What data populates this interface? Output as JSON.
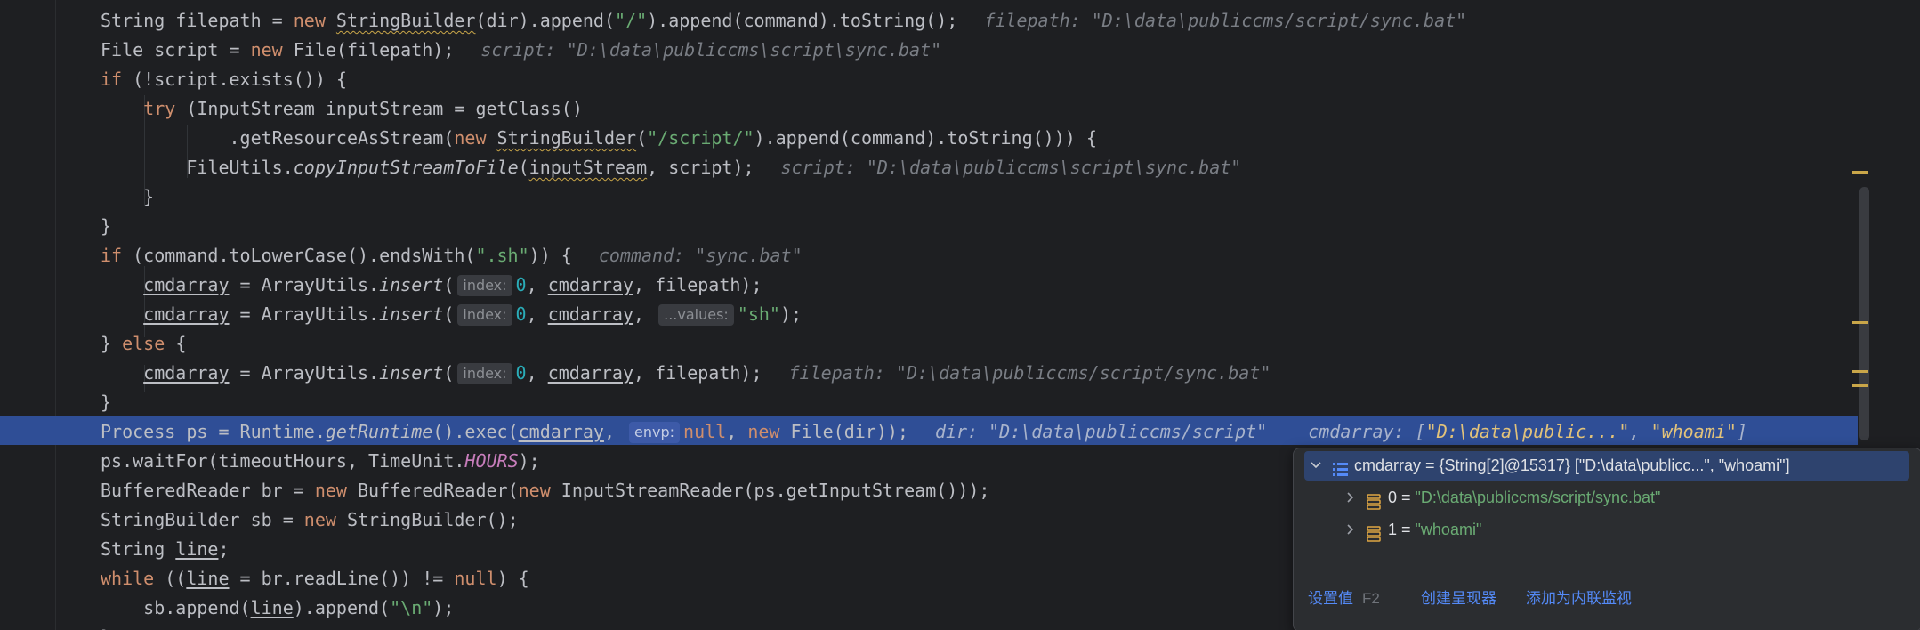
{
  "editor": {
    "lines": [
      [
        {
          "t": "String filepath = "
        },
        {
          "t": "new ",
          "c": "kw"
        },
        {
          "t": "StringBuilder",
          "c": "wavy"
        },
        {
          "t": "(dir).append("
        },
        {
          "t": "\"/\"",
          "c": "str"
        },
        {
          "t": ").append(command).toString();"
        },
        {
          "t": "filepath: \"D:\\data\\publiccms/script/sync.bat\"",
          "c": "inline-hint"
        }
      ],
      [
        {
          "t": "File script = "
        },
        {
          "t": "new ",
          "c": "kw"
        },
        {
          "t": "File(filepath);"
        },
        {
          "t": "script: \"D:\\data\\publiccms\\script\\sync.bat\"",
          "c": "inline-hint"
        }
      ],
      [
        {
          "t": "if ",
          "c": "kw"
        },
        {
          "t": "(!script.exists()) {"
        }
      ],
      [
        {
          "t": "    "
        },
        {
          "t": "try ",
          "c": "kw"
        },
        {
          "t": "(InputStream inputStream = getClass()"
        }
      ],
      [
        {
          "t": "            .getResourceAsStream("
        },
        {
          "t": "new ",
          "c": "kw"
        },
        {
          "t": "StringBuilder",
          "c": "wavy"
        },
        {
          "t": "("
        },
        {
          "t": "\"/script/\"",
          "c": "str"
        },
        {
          "t": ").append(command).toString())) {"
        }
      ],
      [
        {
          "t": "        FileUtils."
        },
        {
          "t": "copyInputStreamToFile",
          "c": "static"
        },
        {
          "t": "("
        },
        {
          "t": "inputStream",
          "c": "wavy"
        },
        {
          "t": ", script);"
        },
        {
          "t": "script: \"D:\\data\\publiccms\\script\\sync.bat\"",
          "c": "inline-hint"
        }
      ],
      [
        {
          "t": "    }"
        }
      ],
      [
        {
          "t": "}"
        }
      ],
      [
        {
          "t": "if ",
          "c": "kw"
        },
        {
          "t": "(command.toLowerCase().endsWith("
        },
        {
          "t": "\".sh\"",
          "c": "str"
        },
        {
          "t": ")) {"
        },
        {
          "t": "command: \"sync.bat\"",
          "c": "inline-hint"
        }
      ],
      [
        {
          "t": "    "
        },
        {
          "t": "cmdarray",
          "c": "ul"
        },
        {
          "t": " = ArrayUtils."
        },
        {
          "t": "insert",
          "c": "static"
        },
        {
          "t": "("
        },
        {
          "t": "index:",
          "c": "param-hint"
        },
        {
          "t": "0",
          "c": "num"
        },
        {
          "t": ", "
        },
        {
          "t": "cmdarray",
          "c": "ul"
        },
        {
          "t": ", filepath);"
        }
      ],
      [
        {
          "t": "    "
        },
        {
          "t": "cmdarray",
          "c": "ul"
        },
        {
          "t": " = ArrayUtils."
        },
        {
          "t": "insert",
          "c": "static"
        },
        {
          "t": "("
        },
        {
          "t": "index:",
          "c": "param-hint"
        },
        {
          "t": "0",
          "c": "num"
        },
        {
          "t": ", "
        },
        {
          "t": "cmdarray",
          "c": "ul"
        },
        {
          "t": ", "
        },
        {
          "t": "...values:",
          "c": "param-hint"
        },
        {
          "t": "\"sh\"",
          "c": "str"
        },
        {
          "t": ");"
        }
      ],
      [
        {
          "t": "} "
        },
        {
          "t": "else ",
          "c": "kw"
        },
        {
          "t": "{"
        }
      ],
      [
        {
          "t": "    "
        },
        {
          "t": "cmdarray",
          "c": "ul"
        },
        {
          "t": " = ArrayUtils."
        },
        {
          "t": "insert",
          "c": "static"
        },
        {
          "t": "("
        },
        {
          "t": "index:",
          "c": "param-hint"
        },
        {
          "t": "0",
          "c": "num"
        },
        {
          "t": ", "
        },
        {
          "t": "cmdarray",
          "c": "ul"
        },
        {
          "t": ", filepath);"
        },
        {
          "t": "filepath: \"D:\\data\\publiccms/script/sync.bat\"",
          "c": "inline-hint"
        }
      ],
      [
        {
          "t": "}"
        }
      ],
      [
        {
          "t": "Process ps = Runtime."
        },
        {
          "t": "getRuntime",
          "c": "static"
        },
        {
          "t": "().exec("
        },
        {
          "t": "cmdarray",
          "c": "ul"
        },
        {
          "t": ", "
        },
        {
          "t": "envp:",
          "c": "param-hint"
        },
        {
          "t": "null",
          "c": "kw"
        },
        {
          "t": ", "
        },
        {
          "t": "new ",
          "c": "kw"
        },
        {
          "t": "File(dir));"
        },
        {
          "t": "dir: \"D:\\data\\publiccms/script\"",
          "c": "inline-hint"
        },
        {
          "t": "cmdarray: [",
          "c": "inline-hint"
        },
        {
          "t": "\"D:\\data\\public...\"",
          "c": "hl-str"
        },
        {
          "t": ", ",
          "c": "inline-hint-plain"
        },
        {
          "t": "\"whoami\"",
          "c": "hl-str"
        },
        {
          "t": "]",
          "c": "inline-hint-plain"
        }
      ],
      [
        {
          "t": "ps.waitFor(timeoutHours, TimeUnit."
        },
        {
          "t": "HOURS",
          "c": "const"
        },
        {
          "t": ");"
        }
      ],
      [
        {
          "t": "BufferedReader br = "
        },
        {
          "t": "new ",
          "c": "kw"
        },
        {
          "t": "BufferedReader("
        },
        {
          "t": "new ",
          "c": "kw"
        },
        {
          "t": "InputStreamReader(ps.getInputStream()));"
        }
      ],
      [
        {
          "t": "StringBuilder sb = "
        },
        {
          "t": "new ",
          "c": "kw"
        },
        {
          "t": "StringBuilder();"
        }
      ],
      [
        {
          "t": "String "
        },
        {
          "t": "line",
          "c": "ul"
        },
        {
          "t": ";"
        }
      ],
      [
        {
          "t": "while ",
          "c": "kw"
        },
        {
          "t": "(("
        },
        {
          "t": "line",
          "c": "ul"
        },
        {
          "t": " = br.readLine()) != "
        },
        {
          "t": "null",
          "c": "kw"
        },
        {
          "t": ") {"
        }
      ],
      [
        {
          "t": "    sb.append("
        },
        {
          "t": "line",
          "c": "ul"
        },
        {
          "t": ").append("
        },
        {
          "t": "\"\\n\"",
          "c": "str"
        },
        {
          "t": ");"
        }
      ],
      [
        {
          "t": "}"
        }
      ]
    ]
  },
  "debug_popup": {
    "root_label": "cmdarray = {String[2]@15317} [\"D:\\data\\publicc...\", \"whoami\"]",
    "items": [
      {
        "index_label": "0 = ",
        "value": "\"D:\\data\\publiccms/script/sync.bat\""
      },
      {
        "index_label": "1 = ",
        "value": "\"whoami\""
      }
    ],
    "footer": {
      "set_value_label": "设置值",
      "set_value_key": "F2",
      "create_renderer_label": "创建呈现器",
      "add_inline_watch_label": "添加为内联监视"
    }
  },
  "colors": {
    "background": "#1e1f22",
    "keyword": "#cf8e6d",
    "string": "#6aab73",
    "number": "#2aacb8",
    "execution_line": "#2f4e96",
    "link": "#548af7"
  }
}
